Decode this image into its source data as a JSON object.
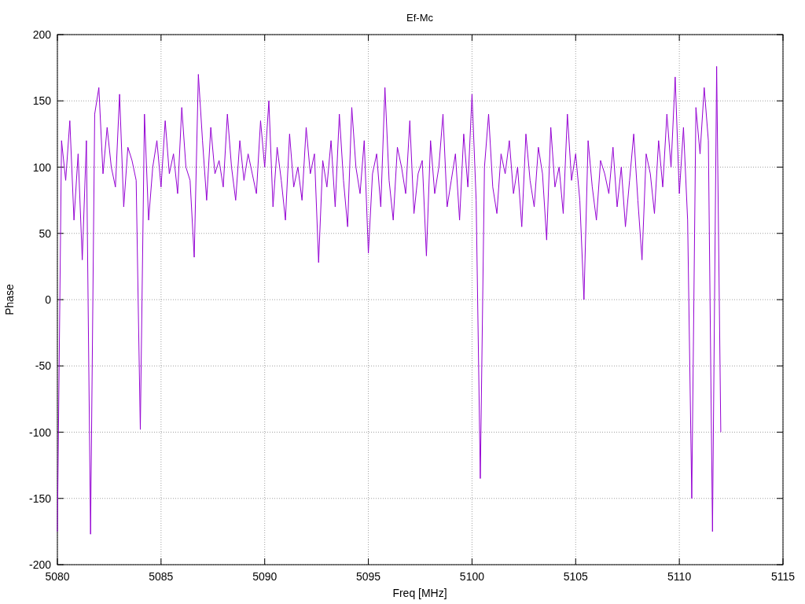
{
  "chart_data": {
    "type": "line",
    "title": "Ef-Mc",
    "xlabel": "Freq [MHz]",
    "ylabel": "Phase",
    "xlim": [
      5080,
      5115
    ],
    "ylim": [
      -200,
      200
    ],
    "xticks": [
      5080,
      5085,
      5090,
      5095,
      5100,
      5105,
      5110,
      5115
    ],
    "yticks": [
      -200,
      -150,
      -100,
      -50,
      0,
      50,
      100,
      150,
      200
    ],
    "grid": true,
    "x": [
      5080,
      5080.2,
      5080.4,
      5080.6,
      5080.8,
      5081,
      5081.2,
      5081.4,
      5081.6,
      5081.8,
      5082,
      5082.2,
      5082.4,
      5082.6,
      5082.8,
      5083,
      5083.2,
      5083.4,
      5083.6,
      5083.8,
      5084,
      5084.2,
      5084.4,
      5084.6,
      5084.8,
      5085,
      5085.2,
      5085.4,
      5085.6,
      5085.8,
      5086,
      5086.2,
      5086.4,
      5086.6,
      5086.8,
      5087,
      5087.2,
      5087.4,
      5087.6,
      5087.8,
      5088,
      5088.2,
      5088.4,
      5088.6,
      5088.8,
      5089,
      5089.2,
      5089.4,
      5089.6,
      5089.8,
      5090,
      5090.2,
      5090.4,
      5090.6,
      5090.8,
      5091,
      5091.2,
      5091.4,
      5091.6,
      5091.8,
      5092,
      5092.2,
      5092.4,
      5092.6,
      5092.8,
      5093,
      5093.2,
      5093.4,
      5093.6,
      5093.8,
      5094,
      5094.2,
      5094.4,
      5094.6,
      5094.8,
      5095,
      5095.2,
      5095.4,
      5095.6,
      5095.8,
      5096,
      5096.2,
      5096.4,
      5096.6,
      5096.8,
      5097,
      5097.2,
      5097.4,
      5097.6,
      5097.8,
      5098,
      5098.2,
      5098.4,
      5098.6,
      5098.8,
      5099,
      5099.2,
      5099.4,
      5099.6,
      5099.8,
      5100,
      5100.2,
      5100.4,
      5100.6,
      5100.8,
      5101,
      5101.2,
      5101.4,
      5101.6,
      5101.8,
      5102,
      5102.2,
      5102.4,
      5102.6,
      5102.8,
      5103,
      5103.2,
      5103.4,
      5103.6,
      5103.8,
      5104,
      5104.2,
      5104.4,
      5104.6,
      5104.8,
      5105,
      5105.2,
      5105.4,
      5105.6,
      5105.8,
      5106,
      5106.2,
      5106.4,
      5106.6,
      5106.8,
      5107,
      5107.2,
      5107.4,
      5107.6,
      5107.8,
      5108,
      5108.2,
      5108.4,
      5108.6,
      5108.8,
      5109,
      5109.2,
      5109.4,
      5109.6,
      5109.8,
      5110,
      5110.2,
      5110.4,
      5110.6,
      5110.8,
      5111,
      5111.2,
      5111.4,
      5111.6,
      5111.8,
      5112
    ],
    "series": [
      {
        "color": "#9400d3",
        "values": [
          -175,
          120,
          90,
          135,
          60,
          110,
          30,
          120,
          -177,
          140,
          160,
          95,
          130,
          100,
          85,
          155,
          70,
          115,
          105,
          90,
          -98,
          140,
          60,
          100,
          120,
          85,
          135,
          95,
          110,
          80,
          145,
          100,
          90,
          32,
          170,
          120,
          75,
          130,
          95,
          105,
          85,
          140,
          100,
          75,
          120,
          90,
          110,
          95,
          80,
          135,
          100,
          150,
          70,
          115,
          90,
          60,
          125,
          85,
          100,
          75,
          130,
          95,
          110,
          28,
          105,
          85,
          120,
          70,
          140,
          90,
          55,
          145,
          100,
          80,
          120,
          35,
          95,
          110,
          70,
          160,
          90,
          60,
          115,
          100,
          80,
          135,
          65,
          95,
          105,
          33,
          120,
          80,
          100,
          140,
          70,
          90,
          110,
          60,
          125,
          85,
          155,
          75,
          -135,
          100,
          140,
          85,
          65,
          110,
          95,
          120,
          80,
          100,
          55,
          125,
          90,
          70,
          115,
          95,
          45,
          130,
          85,
          100,
          65,
          140,
          90,
          110,
          75,
          0,
          120,
          85,
          60,
          105,
          95,
          80,
          115,
          70,
          100,
          55,
          90,
          125,
          75,
          30,
          110,
          95,
          65,
          120,
          85,
          140,
          100,
          168,
          80,
          130,
          60,
          -150,
          145,
          110,
          160,
          120,
          -175,
          176,
          -100
        ]
      }
    ]
  }
}
